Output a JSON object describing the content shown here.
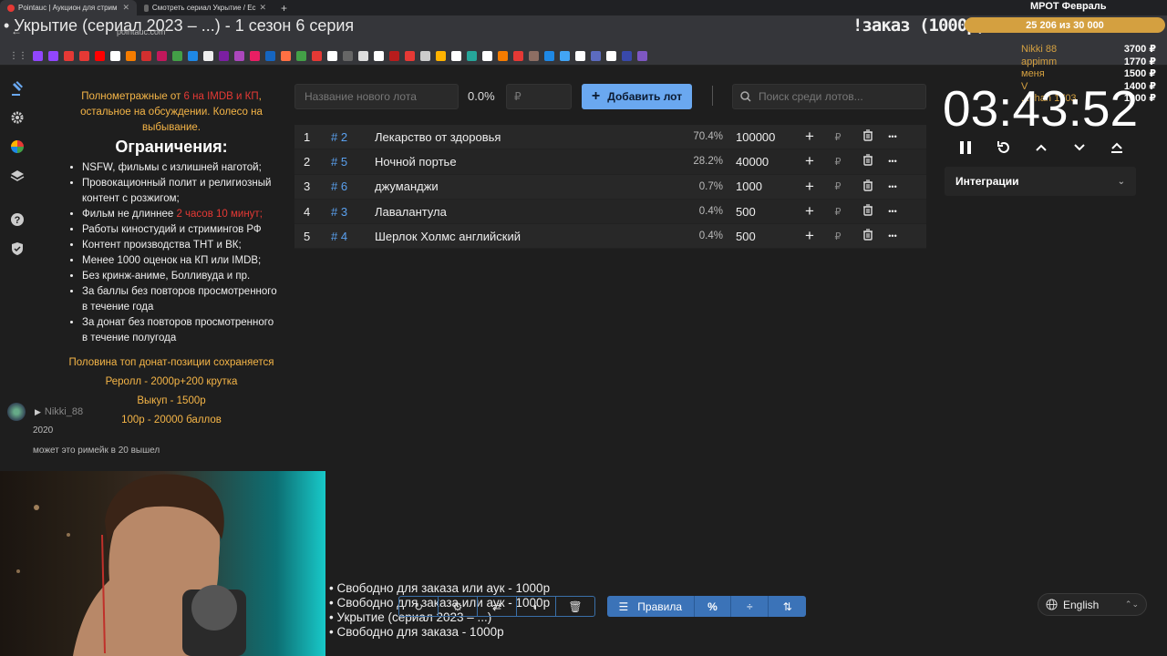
{
  "browser": {
    "tabs": [
      {
        "label": "Pointauc | Аукцион для стрим"
      },
      {
        "label": "Смотреть сериал Укрытие / Ес"
      }
    ],
    "url": "pointauc.com"
  },
  "overlay": {
    "stream_title": "• Укрытие (сериал 2023 – ...) - 1 сезон 6 серия",
    "order_text": "!заказ (1000р)",
    "goal_title": "МРОТ Февраль",
    "goal_progress": "25 206   из 30 000",
    "goal_fraction": 0.84,
    "donors": [
      "Nikki 88",
      "appimm",
      "меня",
      "V",
      "...chan 1703"
    ],
    "donor_amounts": [
      "3700 ₽",
      "1770 ₽",
      "1500 ₽",
      "1400 ₽",
      "1000 ₽"
    ]
  },
  "rules": {
    "intro_a": "Полнометражные от ",
    "intro_red": "6 на IMDB и КП",
    "intro_b": ", остальное на обсуждении. Колесо на выбывание.",
    "heading": "Ограничения:",
    "items": [
      "NSFW, фильмы с излишней наготой;",
      "Провокационный полит и религиозный контент с розжигом;",
      "Фильм не длиннее ",
      "Работы киностудий и стримингов РФ",
      "Контент производства ТНТ и ВК;",
      "Менее 1000 оценок на КП или IMDB;",
      "Без кринж-аниме, Болливуда и пр.",
      "За баллы без повторов просмотренного в течение года",
      "За донат без повторов просмотренного в течение полугода"
    ],
    "length_red": "2 часов 10 минут;",
    "footer": [
      "Половина топ донат-позиции сохраняется",
      "Реролл - 2000р+200 крутка",
      "Выкуп - 1500р",
      "100р - 20000 баллов"
    ]
  },
  "chat": {
    "user": "Nikki_88",
    "year": "2020",
    "message": "может это римейк в 20 вышел"
  },
  "toolbar": {
    "new_lot_placeholder": "Название нового лота",
    "percent": "0.0%",
    "rub_placeholder": "₽",
    "add_label": "Добавить лот",
    "search_placeholder": "Поиск среди лотов..."
  },
  "lots": [
    {
      "num": "1",
      "id": "# 2",
      "name": "Лекарство от здоровья",
      "pct": "70.4%",
      "amount": "100000"
    },
    {
      "num": "2",
      "id": "# 5",
      "name": "Ночной портье",
      "pct": "28.2%",
      "amount": "40000"
    },
    {
      "num": "3",
      "id": "# 6",
      "name": "джуманджи",
      "pct": "0.7%",
      "amount": "1000"
    },
    {
      "num": "4",
      "id": "# 3",
      "name": "Лавалантула",
      "pct": "0.4%",
      "amount": "500"
    },
    {
      "num": "5",
      "id": "# 4",
      "name": "Шерлок Холмс английский",
      "pct": "0.4%",
      "amount": "500"
    }
  ],
  "timer": {
    "value": "03:43:52",
    "integrations_label": "Интеграции"
  },
  "ticker": [
    "• Свободно для заказа или аук - 1000р",
    "• Свободно для заказа или аук - 1000р",
    "• Укрытие (сериал 2023 – ...)",
    "• Свободно для заказа - 1000р"
  ],
  "bottom": {
    "rules_label": "Правила",
    "language": "English"
  },
  "colors": {
    "accent": "#6aa8f0",
    "orange": "#f5b547",
    "red": "#e53935",
    "goal": "#d4a040"
  }
}
